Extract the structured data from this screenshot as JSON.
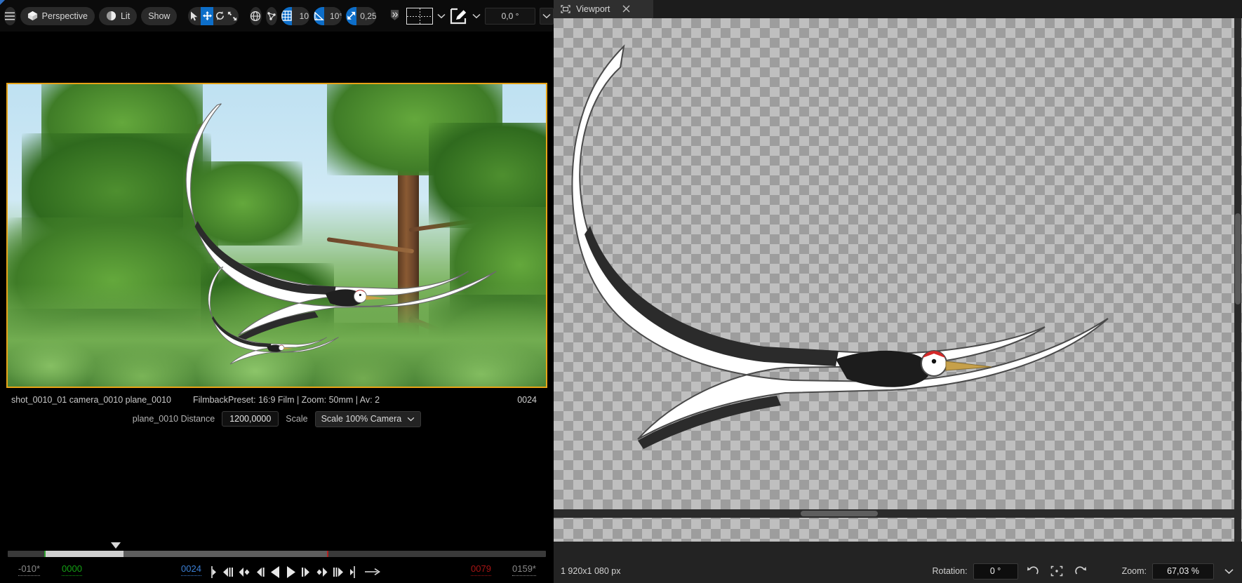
{
  "left_panel": {
    "toolbar": {
      "menu_icon": "hamburger-menu-icon",
      "perspective_label": "Perspective",
      "perspective_icon": "cube-icon",
      "lit_label": "Lit",
      "lit_icon": "half-sphere-icon",
      "show_label": "Show",
      "select_icon": "cursor-arrow-icon",
      "translate_icon": "move-gizmo-icon",
      "rotate_icon": "rotate-gizmo-icon",
      "scale_icon": "scale-gizmo-icon",
      "world_icon": "globe-icon",
      "surface_snap_icon": "surface-snap-icon",
      "grid_snap_icon": "grid-snap-icon",
      "grid_snap_value": "10",
      "angle_snap_icon": "angle-snap-icon",
      "angle_snap_value": "10°",
      "scale_snap_icon": "scale-snap-icon",
      "scale_snap_value": "0,25",
      "overflow_icon": "double-chevron-right-icon",
      "grid_preview_icon": "camera-grid-overlay-icon",
      "grid_dropdown_icon": "chevron-down-icon",
      "draw_icon": "edit-pencil-icon",
      "draw_dropdown_icon": "chevron-down-icon",
      "rotation_value": "0,0 °",
      "rotation_dropdown_icon": "chevron-down-icon"
    },
    "preview": {
      "shot_label": "shot_0010_01  camera_0010  plane_0010",
      "filmback_label": "FilmbackPreset: 16:9 Film | Zoom: 50mm | Av: 2",
      "frame_label": "0024",
      "distance_label": "plane_0010 Distance",
      "distance_value": "1200,0000",
      "scale_label": "Scale",
      "scale_option": "Scale 100% Camera",
      "scale_dropdown_icon": "chevron-down-icon"
    },
    "timeline": {
      "start_limit": "-010*",
      "range_start": "0000",
      "current_frame": "0024",
      "range_end": "0079",
      "end_limit": "0159*",
      "transport": [
        {
          "name": "jump-to-start-button",
          "glyph": "start-bracket-icon"
        },
        {
          "name": "previous-keyframe-button",
          "glyph": "prev-key-icon"
        },
        {
          "name": "previous-key-diamond-button",
          "glyph": "left-diamond-icon"
        },
        {
          "name": "step-back-button",
          "glyph": "step-back-icon"
        },
        {
          "name": "play-reverse-button",
          "glyph": "play-reverse-icon"
        },
        {
          "name": "play-forward-button",
          "glyph": "play-forward-icon"
        },
        {
          "name": "step-forward-button",
          "glyph": "step-forward-icon"
        },
        {
          "name": "next-key-diamond-button",
          "glyph": "right-diamond-icon"
        },
        {
          "name": "next-keyframe-button",
          "glyph": "next-key-icon"
        },
        {
          "name": "jump-to-end-button",
          "glyph": "end-bracket-icon"
        },
        {
          "name": "loop-mode-button",
          "glyph": "arrow-right-icon"
        }
      ]
    }
  },
  "right_panel": {
    "tab": {
      "icon": "viewport-frame-icon",
      "label": "Viewport",
      "close_icon": "close-x-icon"
    },
    "status": {
      "dimensions": "1 920x1 080 px",
      "rotation_label": "Rotation:",
      "rotation_value": "0 °",
      "rotate_ccw_icon": "rotate-counter-clockwise-icon",
      "fit_icon": "fit-to-screen-icon",
      "rotate_cw_icon": "rotate-clockwise-icon",
      "zoom_label": "Zoom:",
      "zoom_value": "67,03 %",
      "zoom_dropdown_icon": "chevron-down-icon"
    }
  },
  "colors": {
    "accent_blue": "#0d6ec9",
    "selection_orange": "#e8a317",
    "green_marker": "#14a014",
    "red_marker": "#a81414",
    "blue_frame": "#3b7fd4"
  }
}
